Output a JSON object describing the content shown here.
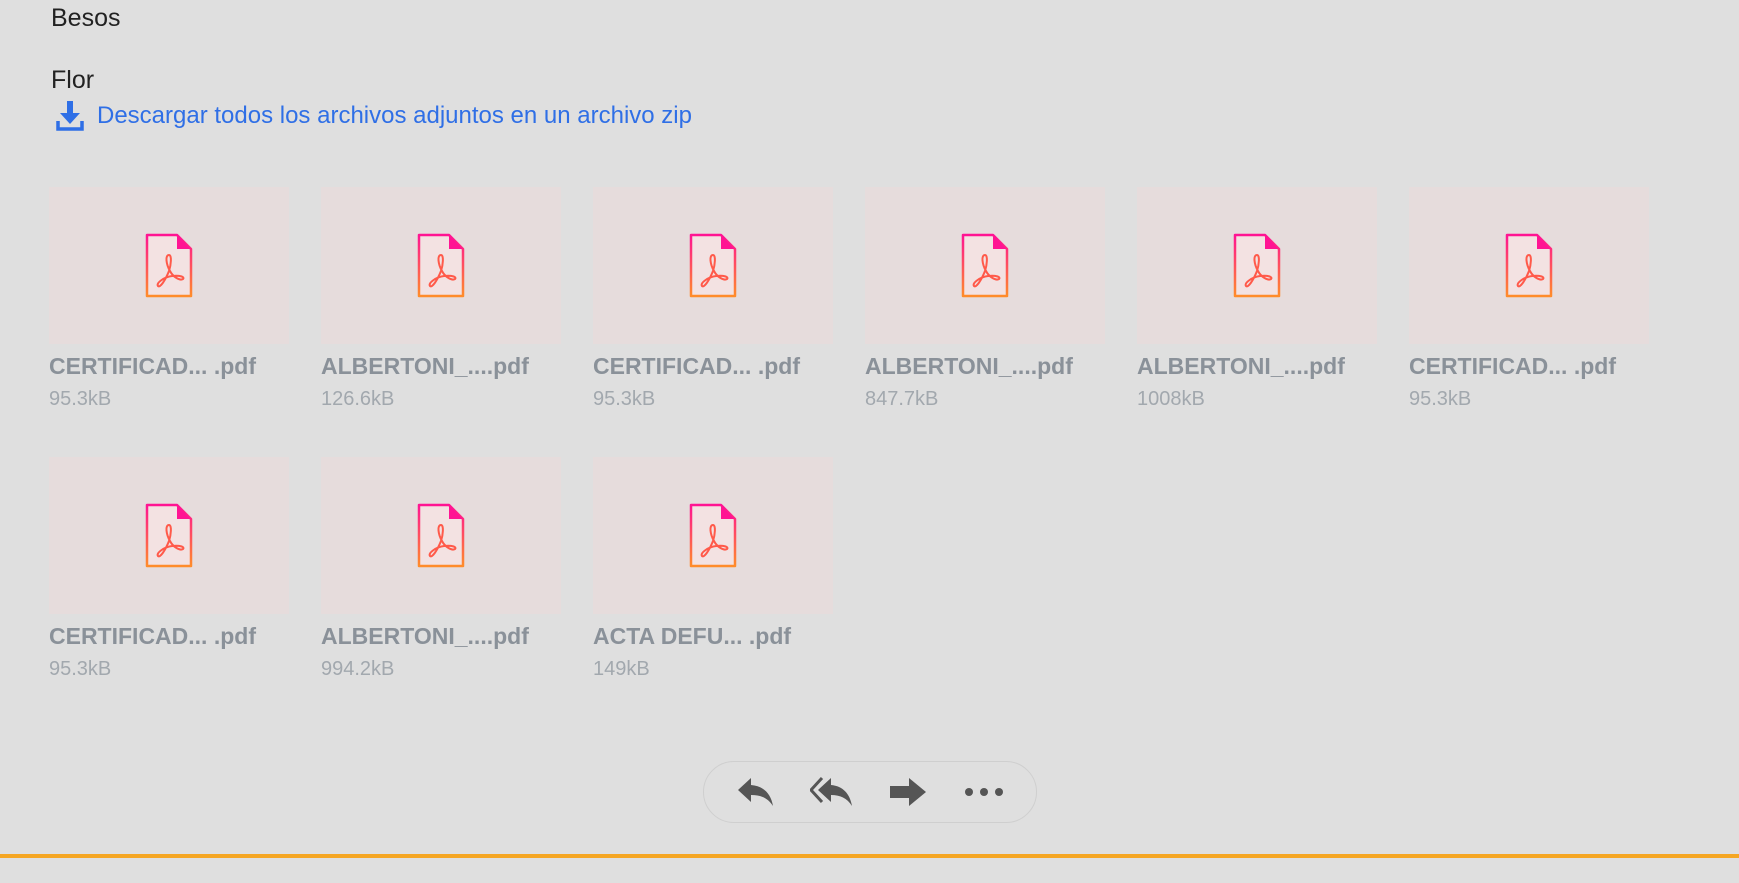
{
  "message": {
    "lines": [
      "Besos",
      "Flor"
    ]
  },
  "download_all": {
    "label": "Descargar todos los archivos adjuntos en un archivo zip",
    "icon": "download-icon",
    "color": "#2f6fe6"
  },
  "attachments": [
    {
      "name": "CERTIFICAD... .pdf",
      "size": "95.3kB",
      "icon": "pdf-file-icon"
    },
    {
      "name": "ALBERTONI_....pdf",
      "size": "126.6kB",
      "icon": "pdf-file-icon"
    },
    {
      "name": "CERTIFICAD... .pdf",
      "size": "95.3kB",
      "icon": "pdf-file-icon"
    },
    {
      "name": "ALBERTONI_....pdf",
      "size": "847.7kB",
      "icon": "pdf-file-icon"
    },
    {
      "name": "ALBERTONI_....pdf",
      "size": "1008kB",
      "icon": "pdf-file-icon"
    },
    {
      "name": "CERTIFICAD... .pdf",
      "size": "95.3kB",
      "icon": "pdf-file-icon"
    },
    {
      "name": "CERTIFICAD... .pdf",
      "size": "95.3kB",
      "icon": "pdf-file-icon"
    },
    {
      "name": "ALBERTONI_....pdf",
      "size": "994.2kB",
      "icon": "pdf-file-icon"
    },
    {
      "name": "ACTA DEFU... .pdf",
      "size": "149kB",
      "icon": "pdf-file-icon"
    }
  ],
  "actions": [
    {
      "icon": "reply-icon"
    },
    {
      "icon": "reply-all-icon"
    },
    {
      "icon": "forward-icon"
    },
    {
      "icon": "more-icon"
    }
  ],
  "colors": {
    "background": "#dfdfdf",
    "thumbnail": "#e6dcdc",
    "accent_bar": "#f5a623",
    "pdf_gradient_top": "#ff1493",
    "pdf_gradient_bottom": "#ff8c2a"
  }
}
